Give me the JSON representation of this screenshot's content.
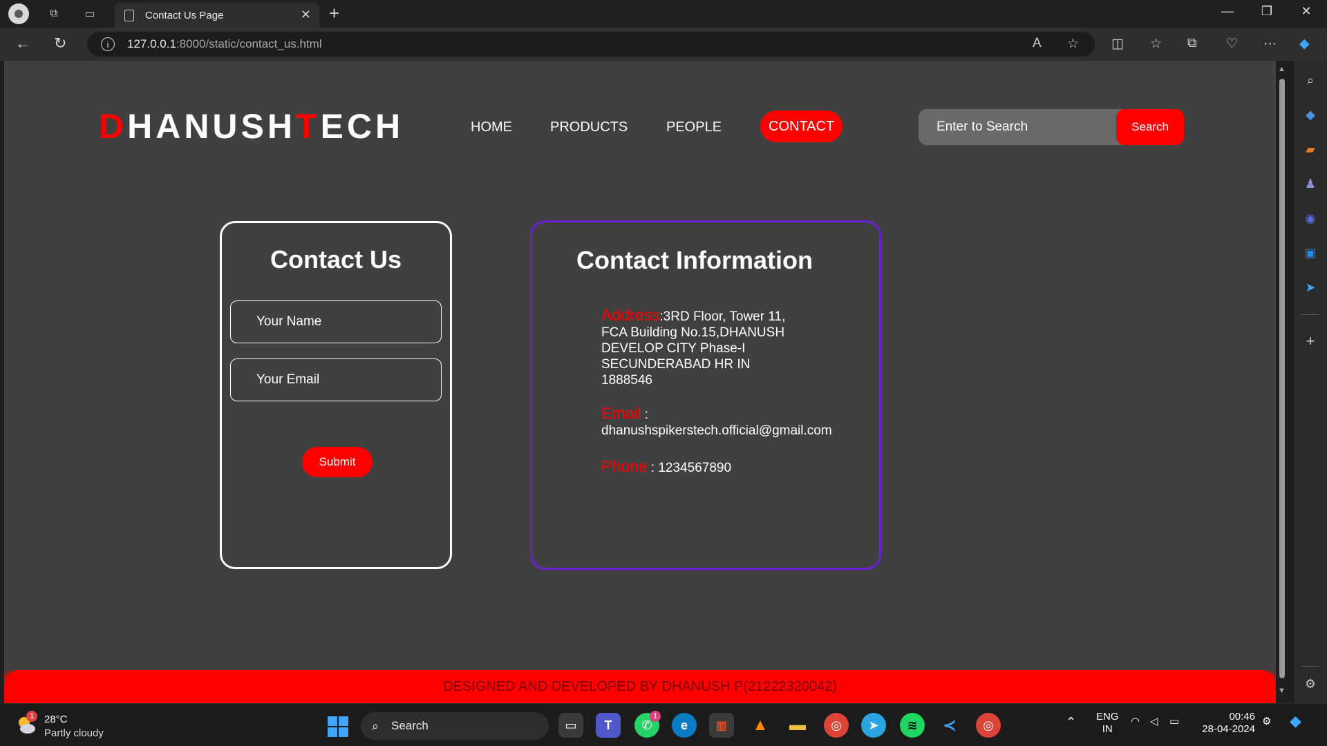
{
  "browser": {
    "tab_title": "Contact Us Page",
    "url_host": "127.0.0.1",
    "url_path": ":8000/static/contact_us.html"
  },
  "site": {
    "logo_letter_1": "D",
    "logo_part_1": "HANUSH",
    "logo_letter_2": "T",
    "logo_part_2": "ECH",
    "nav": [
      {
        "label": "HOME"
      },
      {
        "label": "PRODUCTS"
      },
      {
        "label": "PEOPLE"
      },
      {
        "label": "CONTACT"
      }
    ],
    "search_placeholder": "Enter to Search",
    "search_button": "Search"
  },
  "contact_form": {
    "title": "Contact Us",
    "name_placeholder": "Your Name",
    "email_placeholder": "Your Email",
    "submit_label": "Submit"
  },
  "contact_info": {
    "title": "Contact Information",
    "address_label": "Address",
    "address_line_1": ":3RD Floor, Tower 11,",
    "address_line_2": "FCA Building No.15,DHANUSH",
    "address_line_3": "DEVELOP CITY Phase-I",
    "address_line_4": "SECUNDERABAD HR IN",
    "address_line_5": "1888546",
    "email_label": "Email",
    "email_sep": " :",
    "email_value": "dhanushspikerstech.official@gmail.com",
    "phone_label": "Phone",
    "phone_value": ": 1234567890"
  },
  "footer": {
    "text": "DESIGNED AND DEVELOPED BY DHANUSH P(21222320042)"
  },
  "taskbar": {
    "weather_temp": "28°C",
    "weather_cond": "Partly cloudy",
    "weather_badge": "1",
    "search_label": "Search",
    "whatsapp_badge": "1",
    "lang_1": "ENG",
    "lang_2": "IN",
    "time": "00:46",
    "date": "28-04-2024"
  },
  "colors": {
    "accent": "#ff0000",
    "info_border": "#6a1fd6",
    "page_bg": "#404040"
  }
}
